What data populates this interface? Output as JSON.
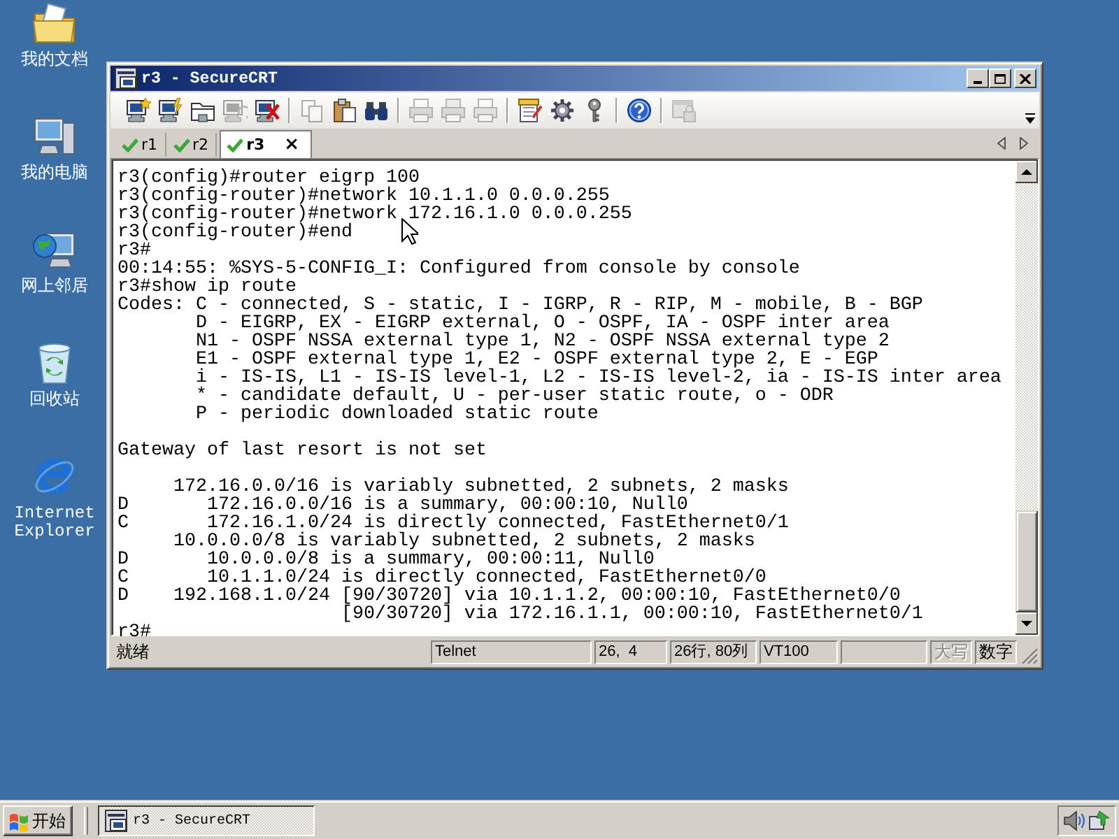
{
  "desktop_icons": [
    {
      "label": "我的文档"
    },
    {
      "label": "我的电脑"
    },
    {
      "label": "网上邻居"
    },
    {
      "label": "回收站"
    },
    {
      "label": "Internet Explorer"
    }
  ],
  "window": {
    "title": "r3 - SecureCRT"
  },
  "toolbar": [
    {
      "disabled": false
    },
    {
      "disabled": false
    },
    {
      "disabled": false
    },
    {
      "disabled": true
    },
    {
      "disabled": false
    },
    {
      "disabled": true
    },
    {
      "disabled": false
    },
    {
      "disabled": false
    },
    {
      "disabled": true
    },
    {
      "disabled": true
    },
    {
      "disabled": true
    },
    {
      "disabled": false
    },
    {
      "disabled": false
    },
    {
      "disabled": false
    },
    {
      "disabled": false
    },
    {
      "disabled": true
    }
  ],
  "tabs": [
    {
      "label": "r1",
      "selected": false
    },
    {
      "label": "r2",
      "selected": false
    },
    {
      "label": "r3",
      "selected": true,
      "close": "×"
    }
  ],
  "terminal": {
    "blocks": [
      [
        "r3(config)#router eigrp 100",
        "r3(config-router)#network 10.1.1.0 0.0.0.255",
        "r3(config-router)#network 172.16.1.0 0.0.0.255",
        "r3(config-router)#end",
        "r3#",
        "00:14:55: %SYS-5-CONFIG_I: Configured from console by console",
        "r3#show ip route",
        "Codes: C - connected, S - static, I - IGRP, R - RIP, M - mobile, B - BGP",
        "       D - EIGRP, EX - EIGRP external, O - OSPF, IA - OSPF inter area",
        "       N1 - OSPF NSSA external type 1, N2 - OSPF NSSA external type 2",
        "       E1 - OSPF external type 1, E2 - OSPF external type 2, E - EGP",
        "       i - IS-IS, L1 - IS-IS level-1, L2 - IS-IS level-2, ia - IS-IS inter area",
        "       * - candidate default, U - per-user static route, o - ODR",
        "       P - periodic downloaded static route"
      ],
      [
        "Gateway of last resort is not set"
      ],
      [
        "     172.16.0.0/16 is variably subnetted, 2 subnets, 2 masks",
        "D       172.16.0.0/16 is a summary, 00:00:10, Null0",
        "C       172.16.1.0/24 is directly connected, FastEthernet0/1",
        "     10.0.0.0/8 is variably subnetted, 2 subnets, 2 masks",
        "D       10.0.0.0/8 is a summary, 00:00:11, Null0",
        "C       10.1.1.0/24 is directly connected, FastEthernet0/0",
        "D    192.168.1.0/24 [90/30720] via 10.1.1.2, 00:00:10, FastEthernet0/0",
        "                    [90/30720] via 172.16.1.1, 00:00:10, FastEthernet0/1",
        "r3#"
      ]
    ]
  },
  "status_bar": {
    "message": "就绪",
    "panels": [
      {
        "text": "Telnet"
      },
      {
        "text": "26,  4"
      },
      {
        "text": "26行, 80列"
      },
      {
        "text": "VT100"
      }
    ],
    "indicators": [
      {
        "text": "大写",
        "on": false
      },
      {
        "text": "数字",
        "on": true
      }
    ]
  },
  "taskbar": {
    "start": "开始",
    "tasks": [
      {
        "label": "r3 - SecureCRT",
        "selected": true
      }
    ]
  }
}
